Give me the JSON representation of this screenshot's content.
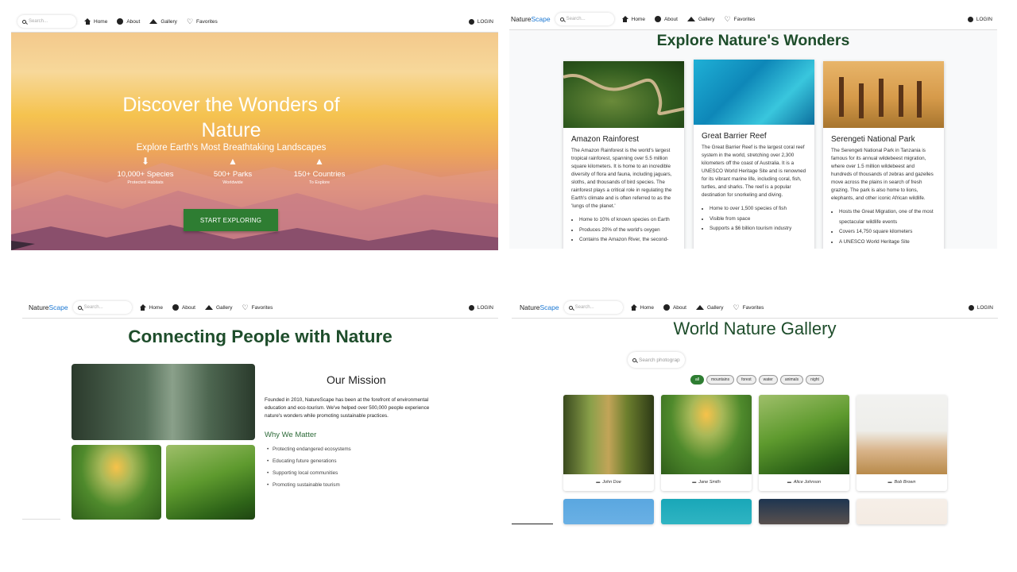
{
  "nav": {
    "brand_plain": "Nature",
    "brand_accent": "Scape",
    "search_placeholder": "Search...",
    "links": [
      "Home",
      "About",
      "Gallery",
      "Favorites"
    ],
    "login": "LOGIN"
  },
  "hero": {
    "title": "Discover the Wonders of Nature",
    "subtitle": "Explore Earth's Most Breathtaking Landscapes",
    "stats": [
      {
        "number": "10,000+ Species",
        "caption": "Protected Habitats",
        "icon": "sprout-icon"
      },
      {
        "number": "500+ Parks",
        "caption": "Worldwide",
        "icon": "tree-icon"
      },
      {
        "number": "150+ Countries",
        "caption": "To Explore",
        "icon": "mountain-icon"
      }
    ],
    "cta": "START EXPLORING"
  },
  "explore": {
    "title": "Explore Nature's Wonders",
    "cards": [
      {
        "title": "Amazon Rainforest",
        "text": "The Amazon Rainforest is the world's largest tropical rainforest, spanning over 5.5 million square kilometers. It is home to an incredible diversity of flora and fauna, including jaguars, sloths, and thousands of bird species. The rainforest plays a critical role in regulating the Earth's climate and is often referred to as the 'lungs of the planet.'",
        "points": [
          "Home to 10% of known species on Earth",
          "Produces 20% of the world's oxygen",
          "Contains the Amazon River, the second-"
        ]
      },
      {
        "title": "Great Barrier Reef",
        "text": "The Great Barrier Reef is the largest coral reef system in the world, stretching over 2,300 kilometers off the coast of Australia. It is a UNESCO World Heritage Site and is renowned for its vibrant marine life, including coral, fish, turtles, and sharks. The reef is a popular destination for snorkeling and diving.",
        "points": [
          "Home to over 1,500 species of fish",
          "Visible from space",
          "Supports a $6 billion tourism industry"
        ]
      },
      {
        "title": "Serengeti National Park",
        "text": "The Serengeti National Park in Tanzania is famous for its annual wildebeest migration, where over 1.5 million wildebeest and hundreds of thousands of zebras and gazelles move across the plains in search of fresh grazing. The park is also home to lions, elephants, and other iconic African wildlife.",
        "points": [
          "Hosts the Great Migration, one of the most spectacular wildlife events",
          "Covers 14,750 square kilometers",
          "A UNESCO World Heritage Site"
        ]
      }
    ]
  },
  "about": {
    "title": "Connecting People with Nature",
    "mission_heading": "Our Mission",
    "mission_text": "Founded in 2010, NatureScape has been at the forefront of environmental education and eco-tourism. We've helped over 500,000 people experience nature's wonders while promoting sustainable practices.",
    "why_heading": "Why We Matter",
    "why_items": [
      "Protecting endangered ecosystems",
      "Educating future generations",
      "Supporting local communities",
      "Promoting sustainable tourism"
    ]
  },
  "gallery": {
    "title": "World Nature Gallery",
    "search_placeholder": "Search photograp",
    "filters": [
      "all",
      "mountains",
      "forest",
      "water",
      "animals",
      "night"
    ],
    "active_filter": "all",
    "authors": [
      "John Doe",
      "Jane Smith",
      "Alice Johnson",
      "Bob Brown"
    ]
  },
  "colors": {
    "brand_green": "#2e7d32",
    "title_green": "#1e4d2b",
    "accent_blue": "#1976d2"
  }
}
